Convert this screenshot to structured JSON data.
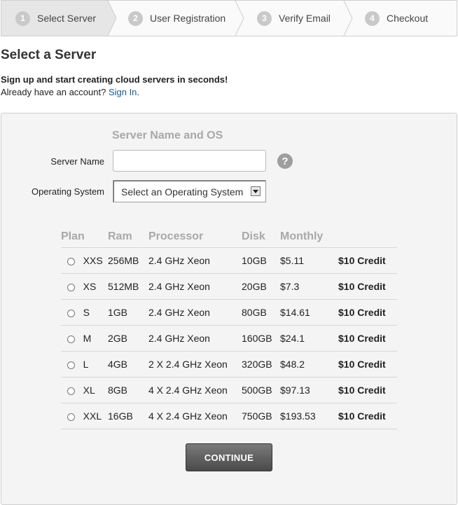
{
  "steps": [
    {
      "num": "1",
      "label": "Select Server"
    },
    {
      "num": "2",
      "label": "User Registration"
    },
    {
      "num": "3",
      "label": "Verify Email"
    },
    {
      "num": "4",
      "label": "Checkout"
    }
  ],
  "page_title": "Select a Server",
  "intro": {
    "bold": "Sign up and start creating cloud servers in seconds!",
    "prefix": "Already have an account? ",
    "link": "Sign In",
    "suffix": "."
  },
  "form": {
    "section_title": "Server Name and OS",
    "server_name_label": "Server Name",
    "server_name_value": "",
    "help_icon": "?",
    "os_label": "Operating System",
    "os_selected": "Select an Operating System"
  },
  "plans": {
    "headers": [
      "Plan",
      "Ram",
      "Processor",
      "Disk",
      "Monthly"
    ],
    "rows": [
      {
        "plan": "XXS",
        "ram": "256MB",
        "processor": "2.4 GHz Xeon",
        "disk": "10GB",
        "monthly": "$5.11",
        "credit": "$10 Credit"
      },
      {
        "plan": "XS",
        "ram": "512MB",
        "processor": "2.4 GHz Xeon",
        "disk": "20GB",
        "monthly": "$7.3",
        "credit": "$10 Credit"
      },
      {
        "plan": "S",
        "ram": "1GB",
        "processor": "2.4 GHz Xeon",
        "disk": "80GB",
        "monthly": "$14.61",
        "credit": "$10 Credit"
      },
      {
        "plan": "M",
        "ram": "2GB",
        "processor": "2.4 GHz Xeon",
        "disk": "160GB",
        "monthly": "$24.1",
        "credit": "$10 Credit"
      },
      {
        "plan": "L",
        "ram": "4GB",
        "processor": "2 X 2.4 GHz Xeon",
        "disk": "320GB",
        "monthly": "$48.2",
        "credit": "$10 Credit"
      },
      {
        "plan": "XL",
        "ram": "8GB",
        "processor": "4 X 2.4 GHz Xeon",
        "disk": "500GB",
        "monthly": "$97.13",
        "credit": "$10 Credit"
      },
      {
        "plan": "XXL",
        "ram": "16GB",
        "processor": "4 X 2.4 GHz Xeon",
        "disk": "750GB",
        "monthly": "$193.53",
        "credit": "$10 Credit"
      }
    ]
  },
  "continue_label": "CONTINUE",
  "colors": {
    "credit": "#5bbd1e",
    "link": "#1a5a96",
    "active_step_bg": "#e6e6e6"
  }
}
